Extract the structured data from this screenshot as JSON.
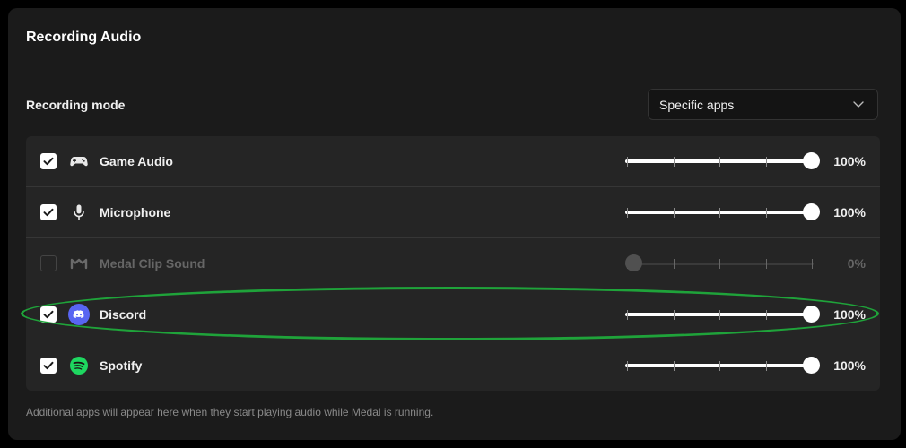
{
  "section_title": "Recording Audio",
  "recording_mode": {
    "label": "Recording mode",
    "selected": "Specific apps"
  },
  "apps": [
    {
      "name": "Game Audio",
      "icon": "gamepad-icon",
      "checked": true,
      "volume": 100,
      "volume_label": "100%"
    },
    {
      "name": "Microphone",
      "icon": "microphone-icon",
      "checked": true,
      "volume": 100,
      "volume_label": "100%"
    },
    {
      "name": "Medal Clip Sound",
      "icon": "medal-icon",
      "checked": false,
      "volume": 0,
      "volume_label": "0%"
    },
    {
      "name": "Discord",
      "icon": "discord-icon",
      "checked": true,
      "volume": 100,
      "volume_label": "100%"
    },
    {
      "name": "Spotify",
      "icon": "spotify-icon",
      "checked": true,
      "volume": 100,
      "volume_label": "100%"
    }
  ],
  "footnote": "Additional apps will appear here when they start playing audio while Medal is running.",
  "colors": {
    "panel": "#1b1b1b",
    "list": "#252525",
    "discord": "#5865f2",
    "spotify": "#1ed760",
    "highlight": "#1fa33a"
  }
}
